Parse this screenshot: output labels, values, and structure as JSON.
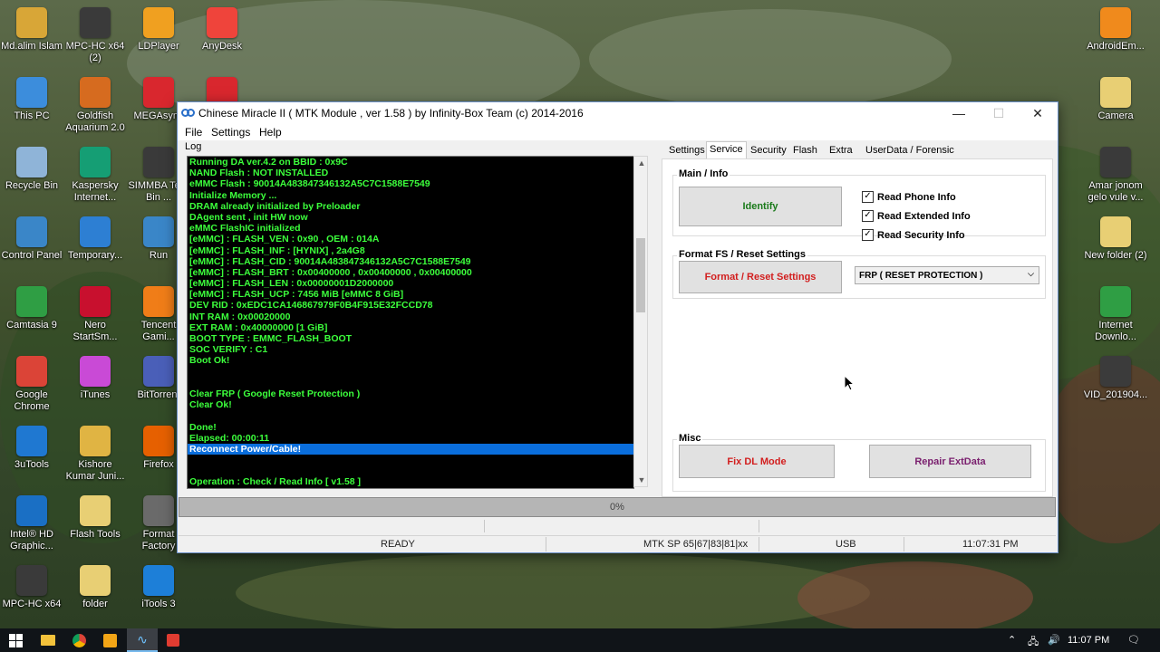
{
  "desktop": {
    "icons_left": [
      {
        "label": "Md.alim Islam",
        "icon": "user-folder-icon",
        "color": "#d8a637"
      },
      {
        "label": "This PC",
        "icon": "computer-icon",
        "color": "#3c8ddc"
      },
      {
        "label": "Recycle Bin",
        "icon": "recycle-bin-icon",
        "color": "#8fb4d8"
      },
      {
        "label": "Control Panel",
        "icon": "control-panel-icon",
        "color": "#3a86c8"
      },
      {
        "label": "Camtasia 9",
        "icon": "camtasia-icon",
        "color": "#2f9e44"
      },
      {
        "label": "Google Chrome",
        "icon": "chrome-icon",
        "color": "#db4437"
      },
      {
        "label": "3uTools",
        "icon": "3utools-icon",
        "color": "#1f78d1"
      },
      {
        "label": "Intel® HD Graphic...",
        "icon": "intel-graphics-icon",
        "color": "#1a6fc4"
      },
      {
        "label": "MPC-HC x64",
        "icon": "mpc-hc-icon",
        "color": "#3a3a3a"
      }
    ],
    "icons_col2": [
      {
        "label": "MPC-HC x64 (2)",
        "icon": "mpc-hc-icon",
        "color": "#3a3a3a"
      },
      {
        "label": "Goldfish Aquarium 2.0",
        "icon": "goldfish-icon",
        "color": "#d66b1f"
      },
      {
        "label": "Kaspersky Internet...",
        "icon": "kaspersky-icon",
        "color": "#159e74"
      },
      {
        "label": "Temporary...",
        "icon": "windows-icon",
        "color": "#2d7fd3"
      },
      {
        "label": "Nero StartSm...",
        "icon": "nero-icon",
        "color": "#c8102e"
      },
      {
        "label": "iTunes",
        "icon": "itunes-icon",
        "color": "#c94ad6"
      },
      {
        "label": "Kishore Kumar Juni...",
        "icon": "folder-icon",
        "color": "#e0b443"
      },
      {
        "label": "Flash Tools",
        "icon": "folder-icon",
        "color": "#e8cf74"
      },
      {
        "label": "folder",
        "icon": "folder-icon",
        "color": "#e8cf74"
      }
    ],
    "icons_col3": [
      {
        "label": "LDPlayer",
        "icon": "ldplayer-icon",
        "color": "#f0a020"
      },
      {
        "label": "MEGAsync",
        "icon": "mega-icon",
        "color": "#d9272e"
      },
      {
        "label": "SIMMBA Tere Bin ...",
        "icon": "mpc-hc-icon",
        "color": "#3a3a3a"
      },
      {
        "label": "Run",
        "icon": "run-icon",
        "color": "#3a86c8"
      },
      {
        "label": "Tencent Gami...",
        "icon": "tencent-icon",
        "color": "#f07d18"
      },
      {
        "label": "BitTorrent",
        "icon": "bittorrent-icon",
        "color": "#4a5fb8"
      },
      {
        "label": "Firefox",
        "icon": "firefox-icon",
        "color": "#e66000"
      },
      {
        "label": "Format Factory",
        "icon": "format-factory-icon",
        "color": "#6a6a6a"
      },
      {
        "label": "iTools 3",
        "icon": "itools-icon",
        "color": "#1d7fd8"
      }
    ],
    "icons_col4": [
      {
        "label": "AnyDesk",
        "icon": "anydesk-icon",
        "color": "#ef443b"
      },
      {
        "label": "",
        "icon": "app-icon",
        "color": "#d9272e"
      }
    ],
    "icons_right": [
      {
        "label": "AndroidEm...",
        "icon": "android-emulator-icon",
        "color": "#f08a1c"
      },
      {
        "label": "Camera",
        "icon": "folder-icon",
        "color": "#e8cf74"
      },
      {
        "label": "Amar jonom gelo vule v...",
        "icon": "mpc-hc-icon",
        "color": "#3a3a3a"
      },
      {
        "label": "New folder (2)",
        "icon": "folder-icon",
        "color": "#e8cf74"
      },
      {
        "label": "Internet Downlo...",
        "icon": "idm-icon",
        "color": "#2f9e44"
      },
      {
        "label": "VID_201904...",
        "icon": "video-file-icon",
        "color": "#3b3b3b"
      }
    ]
  },
  "window": {
    "title": "Chinese Miracle II ( MTK Module , ver 1.58 ) by Infinity-Box Team (c) 2014-2016",
    "controls": {
      "minimize": "—",
      "maximize": "☐",
      "close": "✕"
    },
    "menu": [
      "File",
      "Settings",
      "Help"
    ],
    "log_label": "Log",
    "log_lines": [
      "Running DA ver.4.2 on BBID : 0x9C",
      "NAND Flash : NOT INSTALLED",
      "eMMC Flash : 90014A483847346132A5C7C1588E7549",
      "Initialize Memory ...",
      "DRAM already initialized by Preloader",
      "DAgent sent , init HW now",
      "eMMC FlashIC initialized",
      "[eMMC] : FLASH_VEN : 0x90 , OEM : 014A",
      "[eMMC] : FLASH_INF : [HYNIX] , 2a4G8",
      "[eMMC] : FLASH_CID : 90014A483847346132A5C7C1588E7549",
      "[eMMC] : FLASH_BRT : 0x00400000 , 0x00400000 , 0x00400000",
      "[eMMC] : FLASH_LEN : 0x00000001D2000000",
      "[eMMC] : FLASH_UCP : 7456 MiB [eMMC 8 GiB]",
      "DEV RID    : 0xEDC1CA146867979F0B4F915E32FCCD78",
      "INT RAM    : 0x00020000",
      "EXT RAM    : 0x40000000 [1 GiB]",
      "BOOT TYPE  : EMMC_FLASH_BOOT",
      "SOC VERIFY : C1",
      "Boot Ok!",
      "",
      "",
      "Clear FRP ( Google Reset Protection )",
      "Clear Ok!",
      "",
      "Done!",
      "Elapsed: 00:00:11",
      "Reconnect Power/Cable!",
      "",
      "",
      "Operation : Check / Read Info [ v1.58 ]"
    ],
    "log_selected_index": 26,
    "tabs": [
      "Settings",
      "Service",
      "Security",
      "Flash",
      "Extra",
      "UserData / Forensic"
    ],
    "active_tab": "Service",
    "main_info": {
      "group_label": "Main / Info",
      "identify_label": "Identify",
      "checkboxes": [
        {
          "label": "Read Phone Info",
          "checked": true
        },
        {
          "label": "Read Extended Info",
          "checked": true
        },
        {
          "label": "Read Security Info",
          "checked": true
        }
      ]
    },
    "format": {
      "group_label": "Format FS / Reset Settings",
      "button_label": "Format / Reset Settings",
      "select_value": "FRP ( RESET PROTECTION )"
    },
    "misc": {
      "group_label": "Misc",
      "fix_dl_label": "Fix DL Mode",
      "repair_label": "Repair ExtData"
    },
    "progress": {
      "text": "0%",
      "value": 0
    },
    "status": {
      "state": "READY",
      "chip": "MTK SP 65|67|83|81|xx",
      "port": "USB",
      "time": "11:07:31 PM"
    },
    "colors": {
      "log_text": "#3cff3c",
      "log_selection": "#0a6edc",
      "identify_text": "#1a7a1a",
      "format_text": "#d21e1e",
      "fixdl_text": "#d21e1e",
      "repair_text": "#7a1f6e"
    }
  },
  "taskbar": {
    "clock": "11:07 PM",
    "apps": [
      "windows-start-icon",
      "file-explorer-icon",
      "chrome-icon",
      "media-player-icon",
      "miracle-box-icon",
      "red-app-icon"
    ]
  }
}
